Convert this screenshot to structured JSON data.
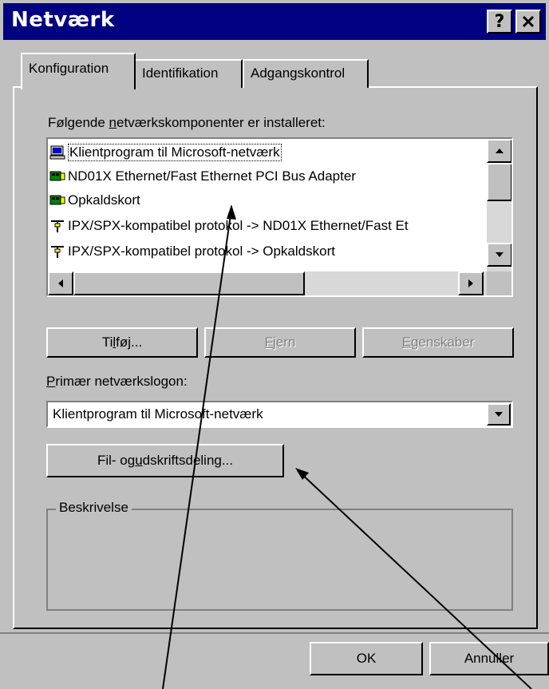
{
  "window": {
    "title": "Netværk",
    "help_glyph": "?",
    "close_glyph": "✕"
  },
  "tabs": [
    {
      "label": "Konfiguration",
      "active": true
    },
    {
      "label": "Identifikation",
      "active": false
    },
    {
      "label": "Adgangskontrol",
      "active": false
    }
  ],
  "components": {
    "label_pre": "Følgende ",
    "label_mnemonic": "n",
    "label_post": "etværkskomponenter er installeret:",
    "items": [
      {
        "icon": "computer-icon",
        "text": "Klientprogram til Microsoft-netværk",
        "selected": true
      },
      {
        "icon": "network-adapter-icon",
        "text": "ND01X Ethernet/Fast Ethernet PCI Bus Adapter"
      },
      {
        "icon": "network-adapter-icon",
        "text": "Opkaldskort"
      },
      {
        "icon": "protocol-icon",
        "text": "IPX/SPX-kompatibel protokol -> ND01X Ethernet/Fast Et"
      },
      {
        "icon": "protocol-icon",
        "text": "IPX/SPX-kompatibel protokol -> Opkaldskort"
      }
    ]
  },
  "buttons": {
    "add_pre": "Ti",
    "add_mnemonic": "l",
    "add_post": "føj...",
    "remove_mnemonic": "F",
    "remove_post": "jern",
    "properties_mnemonic": "E",
    "properties_post": "genskaber",
    "file_print_pre": "Fil- og ",
    "file_print_mnemonic": "u",
    "file_print_post": "dskriftsdeling...",
    "ok": "OK",
    "cancel": "Annuller"
  },
  "logon": {
    "label_mnemonic": "P",
    "label_post": "rimær netværkslogon:",
    "value": "Klientprogram til Microsoft-netværk"
  },
  "description": {
    "label": "Beskrivelse"
  }
}
